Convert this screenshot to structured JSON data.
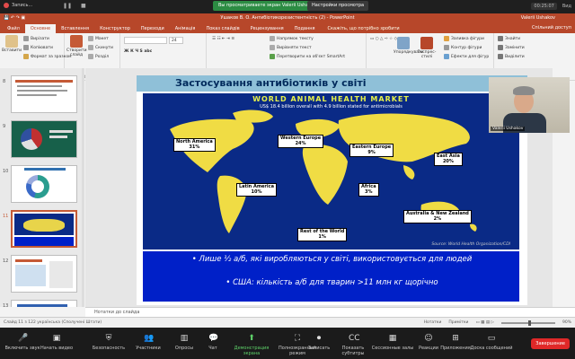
{
  "zoom_top": {
    "recording": "Запись...",
    "banner": "Вы просматриваете экран Valerii Ushakov",
    "banner_button": "Настройки просмотра",
    "timer": "00:25:07",
    "view": "Вид"
  },
  "ppt": {
    "title": "Ушаков В. О. Антибіотикорезистентність (2) - PowerPoint",
    "user": "Valerii Ushakov",
    "tabs": [
      "Файл",
      "Основне",
      "Вставлення",
      "Конструктор",
      "Переходи",
      "Анімація",
      "Показ слайдів",
      "Рецензування",
      "Подання"
    ],
    "active_tab": "Основне",
    "search": "Скажіть, що потрібно зробити",
    "share": "Спільний доступ",
    "ribbon": {
      "clipboard": {
        "label": "Буфер обміну",
        "paste": "Вставити",
        "cut": "Вирізати",
        "copy": "Копіювати",
        "format": "Формат за зразком"
      },
      "slides": {
        "label": "Слайди",
        "new": "Створити слайд",
        "layout": "Макет",
        "reset": "Скинути",
        "section": "Розділ"
      },
      "font": {
        "label": "Шрифт",
        "size": "24"
      },
      "paragraph": {
        "label": "Абзац",
        "dir": "Напрямок тексту",
        "align": "Вирівняти текст",
        "smartart": "Перетворити на об'єкт SmartArt"
      },
      "drawing": {
        "label": "Креслення",
        "arrange": "Упорядкувати",
        "styles": "Експрес-стилі",
        "fill": "Заливка фігури",
        "outline": "Контур фігури",
        "effects": "Ефекти для фігур"
      },
      "editing": {
        "label": "Редагування",
        "find": "Знайти",
        "replace": "Замінити",
        "select": "Виділити"
      }
    }
  },
  "thumbs": [
    {
      "num": "8"
    },
    {
      "num": "9"
    },
    {
      "num": "10"
    },
    {
      "num": "11"
    },
    {
      "num": "12"
    },
    {
      "num": "13"
    }
  ],
  "slide": {
    "title": "Застосування антибіотиків у світі",
    "map_head": "WORLD ANIMAL HEALTH MARKET",
    "map_sub": "US$ 18.4 billion overall with 4.9 billion stated for antimicrobials",
    "regions": [
      {
        "name": "North America",
        "value": "31%"
      },
      {
        "name": "Western Europe",
        "value": "24%"
      },
      {
        "name": "Eastern Europe",
        "value": "9%"
      },
      {
        "name": "East Asia",
        "value": "20%"
      },
      {
        "name": "Latin America",
        "value": "10%"
      },
      {
        "name": "Africa",
        "value": "3%"
      },
      {
        "name": "Australia & New Zealand",
        "value": "2%"
      },
      {
        "name": "Rest of the World",
        "value": "1%"
      }
    ],
    "source": "Source: World Health Organization/CDI",
    "bullet1": "• Лише ½ а/б, які виробляються у світі, використовується для людей",
    "bullet2": "• США: кількість а/б для тварин >11 млн кг щорічно"
  },
  "notes": "Нотатки до слайда",
  "status": {
    "left": "Слайд 11 з 122   українська (Сполучені Штати)",
    "notes": "Нотатки",
    "comments": "Примітки",
    "zoom": "90%"
  },
  "video": {
    "name": "Valerii Ushakov"
  },
  "zoom_bar": {
    "buttons": [
      "Включить звук",
      "Начать видео",
      "Безопасность",
      "Участники",
      "Опросы",
      "Чат",
      "Демонстрация экрана",
      "Полноэкранный режим",
      "Записать",
      "Показать субтитры",
      "Сессионные залы",
      "Реакции",
      "Приложения",
      "Доска сообщений"
    ],
    "participants_count": "30",
    "end": "Завершение"
  }
}
